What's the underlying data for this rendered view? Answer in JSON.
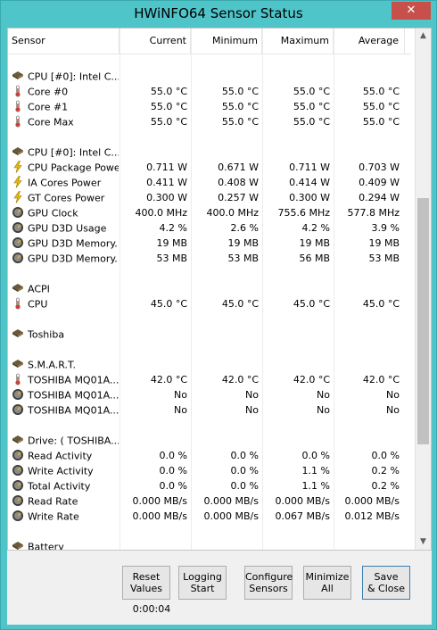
{
  "window": {
    "title": "HWiNFO64 Sensor Status",
    "close_label": "✕"
  },
  "columns": [
    "Sensor",
    "Current",
    "Minimum",
    "Maximum",
    "Average"
  ],
  "rows": [
    {
      "type": "blank"
    },
    {
      "type": "group",
      "icon": "chip-icon",
      "name": "CPU [#0]: Intel C..."
    },
    {
      "type": "data",
      "icon": "thermometer-icon",
      "name": "Core #0",
      "current": "55.0 °C",
      "minimum": "55.0 °C",
      "maximum": "55.0 °C",
      "average": "55.0 °C"
    },
    {
      "type": "data",
      "icon": "thermometer-icon",
      "name": "Core #1",
      "current": "55.0 °C",
      "minimum": "55.0 °C",
      "maximum": "55.0 °C",
      "average": "55.0 °C"
    },
    {
      "type": "data",
      "icon": "thermometer-icon",
      "name": "Core Max",
      "current": "55.0 °C",
      "minimum": "55.0 °C",
      "maximum": "55.0 °C",
      "average": "55.0 °C"
    },
    {
      "type": "blank"
    },
    {
      "type": "group",
      "icon": "chip-icon",
      "name": "CPU [#0]: Intel C..."
    },
    {
      "type": "data",
      "icon": "lightning-icon",
      "name": "CPU Package Power",
      "current": "0.711 W",
      "minimum": "0.671 W",
      "maximum": "0.711 W",
      "average": "0.703 W"
    },
    {
      "type": "data",
      "icon": "lightning-icon",
      "name": "IA Cores Power",
      "current": "0.411 W",
      "minimum": "0.408 W",
      "maximum": "0.414 W",
      "average": "0.409 W"
    },
    {
      "type": "data",
      "icon": "lightning-icon",
      "name": "GT Cores Power",
      "current": "0.300 W",
      "minimum": "0.257 W",
      "maximum": "0.300 W",
      "average": "0.294 W"
    },
    {
      "type": "data",
      "icon": "gauge-icon",
      "name": "GPU Clock",
      "current": "400.0 MHz",
      "minimum": "400.0 MHz",
      "maximum": "755.6 MHz",
      "average": "577.8 MHz"
    },
    {
      "type": "data",
      "icon": "gauge-icon",
      "name": "GPU D3D Usage",
      "current": "4.2 %",
      "minimum": "2.6 %",
      "maximum": "4.2 %",
      "average": "3.9 %"
    },
    {
      "type": "data",
      "icon": "gauge-icon",
      "name": "GPU D3D Memory...",
      "current": "19 MB",
      "minimum": "19 MB",
      "maximum": "19 MB",
      "average": "19 MB"
    },
    {
      "type": "data",
      "icon": "gauge-icon",
      "name": "GPU D3D Memory...",
      "current": "53 MB",
      "minimum": "53 MB",
      "maximum": "56 MB",
      "average": "53 MB"
    },
    {
      "type": "blank"
    },
    {
      "type": "group",
      "icon": "chip-icon",
      "name": "ACPI"
    },
    {
      "type": "data",
      "icon": "thermometer-icon",
      "name": "CPU",
      "current": "45.0 °C",
      "minimum": "45.0 °C",
      "maximum": "45.0 °C",
      "average": "45.0 °C"
    },
    {
      "type": "blank"
    },
    {
      "type": "group",
      "icon": "chip-icon",
      "name": "Toshiba"
    },
    {
      "type": "blank"
    },
    {
      "type": "group",
      "icon": "chip-icon",
      "name": "S.M.A.R.T."
    },
    {
      "type": "data",
      "icon": "thermometer-icon",
      "name": "TOSHIBA MQ01A...",
      "current": "42.0 °C",
      "minimum": "42.0 °C",
      "maximum": "42.0 °C",
      "average": "42.0 °C"
    },
    {
      "type": "data",
      "icon": "gauge-icon",
      "name": "TOSHIBA MQ01A...",
      "current": "No",
      "minimum": "No",
      "maximum": "No",
      "average": "No"
    },
    {
      "type": "data",
      "icon": "gauge-icon",
      "name": "TOSHIBA MQ01A...",
      "current": "No",
      "minimum": "No",
      "maximum": "No",
      "average": "No"
    },
    {
      "type": "blank"
    },
    {
      "type": "group",
      "icon": "chip-icon",
      "name": "Drive: ( TOSHIBA..."
    },
    {
      "type": "data",
      "icon": "gauge-icon",
      "name": "Read Activity",
      "current": "0.0 %",
      "minimum": "0.0 %",
      "maximum": "0.0 %",
      "average": "0.0 %"
    },
    {
      "type": "data",
      "icon": "gauge-icon",
      "name": "Write Activity",
      "current": "0.0 %",
      "minimum": "0.0 %",
      "maximum": "1.1 %",
      "average": "0.2 %"
    },
    {
      "type": "data",
      "icon": "gauge-icon",
      "name": "Total Activity",
      "current": "0.0 %",
      "minimum": "0.0 %",
      "maximum": "1.1 %",
      "average": "0.2 %"
    },
    {
      "type": "data",
      "icon": "gauge-icon",
      "name": "Read Rate",
      "current": "0.000 MB/s",
      "minimum": "0.000 MB/s",
      "maximum": "0.000 MB/s",
      "average": "0.000 MB/s"
    },
    {
      "type": "data",
      "icon": "gauge-icon",
      "name": "Write Rate",
      "current": "0.000 MB/s",
      "minimum": "0.000 MB/s",
      "maximum": "0.067 MB/s",
      "average": "0.012 MB/s"
    },
    {
      "type": "blank"
    },
    {
      "type": "group",
      "icon": "chip-icon",
      "name": "Battery"
    }
  ],
  "buttons": [
    {
      "id": "reset-values-button",
      "line1": "Reset",
      "line2": "Values"
    },
    {
      "id": "logging-start-button",
      "line1": "Logging",
      "line2": "Start"
    },
    {
      "id": "configure-sensors-button",
      "line1": "Configure",
      "line2": "Sensors"
    },
    {
      "id": "minimize-all-button",
      "line1": "Minimize",
      "line2": "All"
    },
    {
      "id": "save-close-button",
      "line1": "Save",
      "line2": "& Close"
    }
  ],
  "timer": "0:00:04",
  "colors": {
    "titlebar": "#4fc4c9",
    "close": "#c7514a",
    "thermo": "#d63b2a",
    "lightning": "#e8b80c",
    "gauge": "#3a3a3a",
    "chip": "#6b5a3a"
  }
}
